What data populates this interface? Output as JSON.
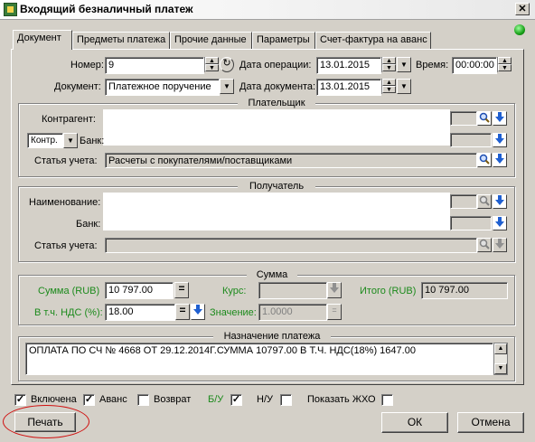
{
  "window": {
    "title": "Входящий безналичный платеж",
    "close_glyph": "✕"
  },
  "tabs": [
    {
      "label": "Документ"
    },
    {
      "label": "Предметы платежа"
    },
    {
      "label": "Прочие данные"
    },
    {
      "label": "Параметры"
    },
    {
      "label": "Счет-фактура на аванс"
    }
  ],
  "document": {
    "number_label": "Номер:",
    "number_value": "9",
    "op_date_label": "Дата операции:",
    "op_date_value": "13.01.2015",
    "time_label": "Время:",
    "time_value": "00:00:00",
    "doc_type_label": "Документ:",
    "doc_type_value": "Платежное поручение",
    "doc_date_label": "Дата документа:",
    "doc_date_value": "13.01.2015"
  },
  "payer": {
    "title": "Плательщик",
    "counterparty_label": "Контрагент:",
    "bank_label": "Банк:",
    "kind_value": "Контр.",
    "account_label": "Статья учета:",
    "account_value": "Расчеты с покупателями/поставщиками"
  },
  "receiver": {
    "title": "Получатель",
    "name_label": "Наименование:",
    "bank_label": "Банк:",
    "account_label": "Статья учета:"
  },
  "sum": {
    "title": "Сумма",
    "amount_label": "Сумма (RUB)",
    "amount_value": "10 797.00",
    "rate_label": "Курс:",
    "total_label": "Итого (RUB)",
    "total_value": "10 797.00",
    "vat_label": "В т.ч. НДС (%):",
    "vat_value": "18.00",
    "value_label": "Значение:",
    "value_value": "1.0000",
    "equals": "="
  },
  "purpose": {
    "title": "Назначение платежа",
    "text": "ОПЛАТА ПО СЧ № 4668 ОТ 29.12.2014Г.СУММА 10797.00 В Т.Ч. НДС(18%) 1647.00"
  },
  "bottom": {
    "included_label": "Включена",
    "included": true,
    "advance_label": "Аванс",
    "advance": true,
    "return_label": "Возврат",
    "return": false,
    "bu_label": "Б/У",
    "bu": true,
    "nu_label": "Н/У",
    "nu": false,
    "show_label": "Показать ЖХО",
    "show": false,
    "check_glyph": "✓"
  },
  "buttons": {
    "print": "Печать",
    "ok": "ОК",
    "cancel": "Отмена"
  },
  "colors": {
    "accent_green": "#1c8a1c",
    "annotation_red": "#d01010"
  }
}
